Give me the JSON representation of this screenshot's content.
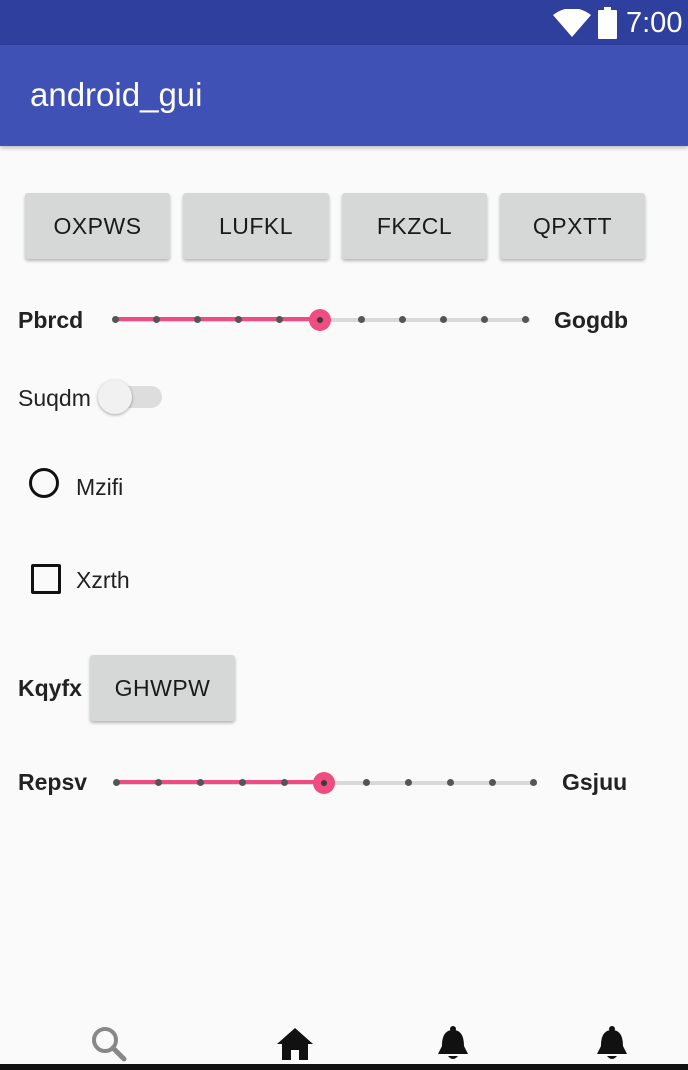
{
  "status_bar": {
    "time": "7:00",
    "icons": [
      "wifi-icon",
      "battery-icon"
    ],
    "color": "#2f3f9e"
  },
  "app_bar": {
    "title": "android_gui",
    "color": "#3f51b5"
  },
  "buttons_row": [
    "OXPWS",
    "LUFKL",
    "FKZCL",
    "QPXTT"
  ],
  "slider1": {
    "left_label": "Pbrcd",
    "right_label": "Gogdb",
    "steps": 10,
    "value": 5
  },
  "switch": {
    "label": "Suqdm",
    "checked": false
  },
  "radio": {
    "label": "Mzifi",
    "checked": false
  },
  "checkbox": {
    "label": "Xzrth",
    "checked": false
  },
  "button_row2": {
    "label": "Kqyfx",
    "button": "GHWPW"
  },
  "slider2": {
    "left_label": "Repsv",
    "right_label": "Gsjuu",
    "steps": 10,
    "value": 5
  },
  "bottom_nav": [
    "search-icon",
    "home-icon",
    "bell-icon",
    "bell-icon"
  ],
  "accent_color": "#ef4d82"
}
